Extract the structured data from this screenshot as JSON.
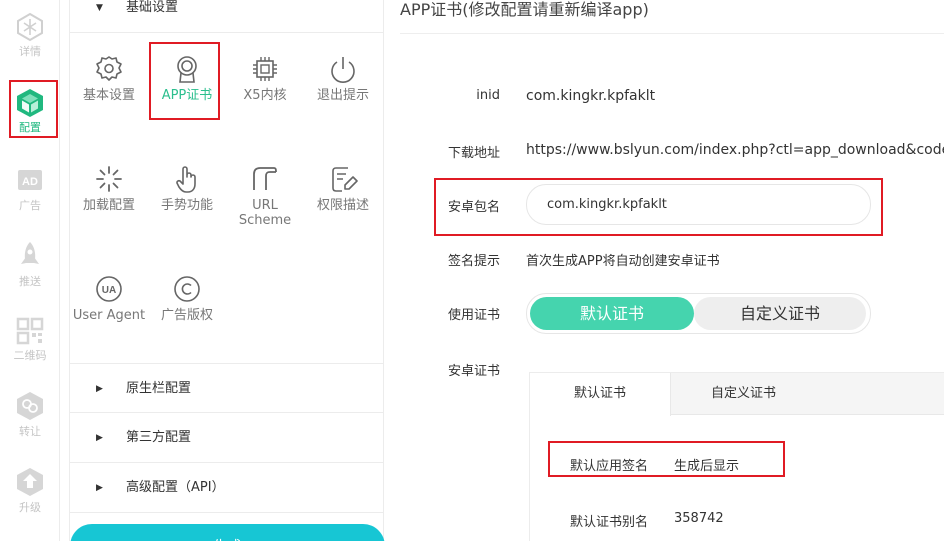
{
  "rail": {
    "items": [
      {
        "label": "详情",
        "icon": "hexagon-details-icon"
      },
      {
        "label": "配置",
        "icon": "cube-config-icon",
        "active": true
      },
      {
        "label": "广告",
        "icon": "ad-icon"
      },
      {
        "label": "推送",
        "icon": "rocket-icon"
      },
      {
        "label": "二维码",
        "icon": "qr-code-icon"
      },
      {
        "label": "转让",
        "icon": "transfer-icon"
      },
      {
        "label": "升级",
        "icon": "upgrade-arrow-icon"
      }
    ]
  },
  "panel": {
    "basic_section": "基础设置",
    "tools": [
      {
        "label": "基本设置",
        "icon": "gear-icon"
      },
      {
        "label": "APP证书",
        "icon": "certificate-icon",
        "active": true
      },
      {
        "label": "X5内核",
        "icon": "chip-icon"
      },
      {
        "label": "退出提示",
        "icon": "power-icon"
      },
      {
        "label": "加载配置",
        "icon": "loading-spinner-icon"
      },
      {
        "label": "手势功能",
        "icon": "hand-pointer-icon"
      },
      {
        "label": "URL Scheme",
        "icon": "url-scheme-icon"
      },
      {
        "label": "权限描述",
        "icon": "edit-note-icon"
      },
      {
        "label": "User Agent",
        "icon": "ua-icon"
      },
      {
        "label": "广告版权",
        "icon": "copyright-icon"
      }
    ],
    "sections": [
      "原生栏配置",
      "第三方配置",
      "高级配置（API）"
    ],
    "generate_label": "生成"
  },
  "main": {
    "title": "APP证书(修改配置请重新编译app)",
    "inid_label": "inid",
    "inid_value": "com.kingkr.kpfaklt",
    "download_label": "下载地址",
    "download_value": "https://www.bslyun.com/index.php?ctl=app_download&code=",
    "package_label": "安卓包名",
    "package_value": "com.kingkr.kpfaklt",
    "sign_hint_label": "签名提示",
    "sign_hint_value": "首次生成APP将自动创建安卓证书",
    "use_cert_label": "使用证书",
    "toggle": {
      "default": "默认证书",
      "custom": "自定义证书"
    },
    "android_cert_label": "安卓证书",
    "tabs": {
      "default": "默认证书",
      "custom": "自定义证书"
    },
    "default_sign_label": "默认应用签名",
    "default_sign_value": "生成后显示",
    "alias_label": "默认证书别名",
    "alias_value": "358742"
  },
  "colors": {
    "accent": "#2bbf8e",
    "toggle_on": "#45d4ae",
    "highlight": "#e01b24",
    "generate": "#17c6d4"
  }
}
